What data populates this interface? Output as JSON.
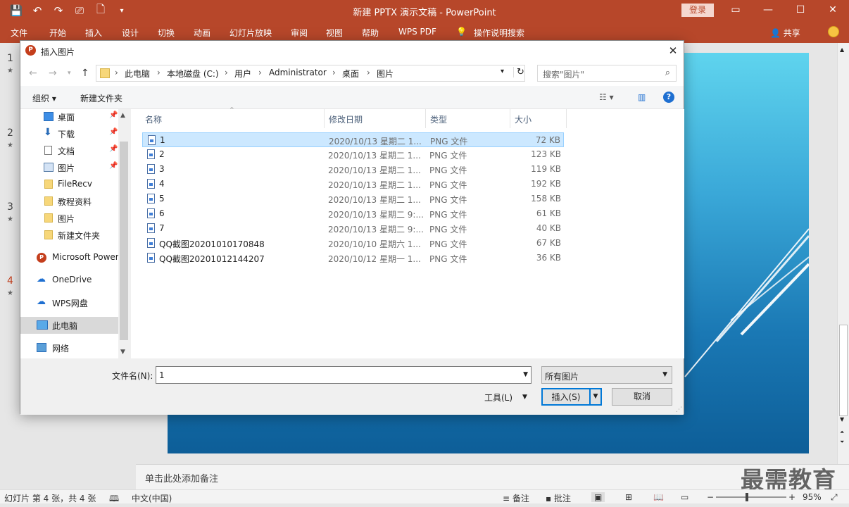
{
  "window": {
    "title": "新建 PPTX 演示文稿 - PowerPoint",
    "login_label": "登录",
    "minimize": "—",
    "restore": "☐",
    "close": "✕",
    "ribbon_display": "▭"
  },
  "ribbon": {
    "tabs": [
      "文件",
      "开始",
      "插入",
      "设计",
      "切换",
      "动画",
      "幻灯片放映",
      "审阅",
      "视图",
      "帮助",
      "WPS PDF",
      "操作说明搜索"
    ],
    "share_label": "共享"
  },
  "slides_panel": {
    "numbers": [
      "1",
      "2",
      "3",
      "4"
    ],
    "active_index": 3
  },
  "notes": {
    "placeholder": "单击此处添加备注"
  },
  "watermark": "最需教育",
  "statusbar": {
    "slide_info": "幻灯片 第 4 张，共 4 张",
    "language": "中文(中国)",
    "notes_label": "备注",
    "comments_label": "批注",
    "zoom_minus": "−",
    "zoom_plus": "+",
    "zoom_level": "95%"
  },
  "dialog": {
    "title": "插入图片",
    "close": "✕",
    "address_segments": [
      "此电脑",
      "本地磁盘 (C:)",
      "用户",
      "Administrator",
      "桌面",
      "图片"
    ],
    "search_placeholder": "搜索\"图片\"",
    "organize_label": "组织 ▾",
    "new_folder_label": "新建文件夹",
    "help_label": "?",
    "nav_items": [
      {
        "label": "桌面",
        "icon": "desktop-icon",
        "pinned": true
      },
      {
        "label": "下载",
        "icon": "download-icon",
        "pinned": true
      },
      {
        "label": "文档",
        "icon": "document-icon",
        "pinned": true
      },
      {
        "label": "图片",
        "icon": "pictures-icon",
        "pinned": true
      },
      {
        "label": "FileRecv",
        "icon": "folder-icon",
        "pinned": false
      },
      {
        "label": "教程资料",
        "icon": "folder-icon",
        "pinned": false
      },
      {
        "label": "图片",
        "icon": "folder-icon",
        "pinned": false
      },
      {
        "label": "新建文件夹",
        "icon": "folder-icon",
        "pinned": false
      },
      {
        "label": "Microsoft Power",
        "icon": "powerpoint-icon",
        "pinned": false
      },
      {
        "label": "OneDrive",
        "icon": "cloud-icon",
        "pinned": false
      },
      {
        "label": "WPS网盘",
        "icon": "cloud-outline-icon",
        "pinned": false
      },
      {
        "label": "此电脑",
        "icon": "computer-icon",
        "pinned": false,
        "selected": true
      },
      {
        "label": "网络",
        "icon": "network-icon",
        "pinned": false
      }
    ],
    "columns": [
      "名称",
      "修改日期",
      "类型",
      "大小"
    ],
    "files": [
      {
        "name": "1",
        "date": "2020/10/13 星期二 1...",
        "type": "PNG 文件",
        "size": "72 KB",
        "selected": true
      },
      {
        "name": "2",
        "date": "2020/10/13 星期二 1...",
        "type": "PNG 文件",
        "size": "123 KB"
      },
      {
        "name": "3",
        "date": "2020/10/13 星期二 1...",
        "type": "PNG 文件",
        "size": "119 KB"
      },
      {
        "name": "4",
        "date": "2020/10/13 星期二 1...",
        "type": "PNG 文件",
        "size": "192 KB"
      },
      {
        "name": "5",
        "date": "2020/10/13 星期二 1...",
        "type": "PNG 文件",
        "size": "158 KB"
      },
      {
        "name": "6",
        "date": "2020/10/13 星期二 9:...",
        "type": "PNG 文件",
        "size": "61 KB"
      },
      {
        "name": "7",
        "date": "2020/10/13 星期二 9:...",
        "type": "PNG 文件",
        "size": "40 KB"
      },
      {
        "name": "QQ截图20201010170848",
        "date": "2020/10/10 星期六 1...",
        "type": "PNG 文件",
        "size": "67 KB"
      },
      {
        "name": "QQ截图20201012144207",
        "date": "2020/10/12 星期一 1...",
        "type": "PNG 文件",
        "size": "36 KB"
      }
    ],
    "filename_label": "文件名(N):",
    "filename_value": "1",
    "filter_value": "所有图片",
    "tools_label": "工具(L)",
    "insert_label": "插入(S)",
    "cancel_label": "取消"
  }
}
